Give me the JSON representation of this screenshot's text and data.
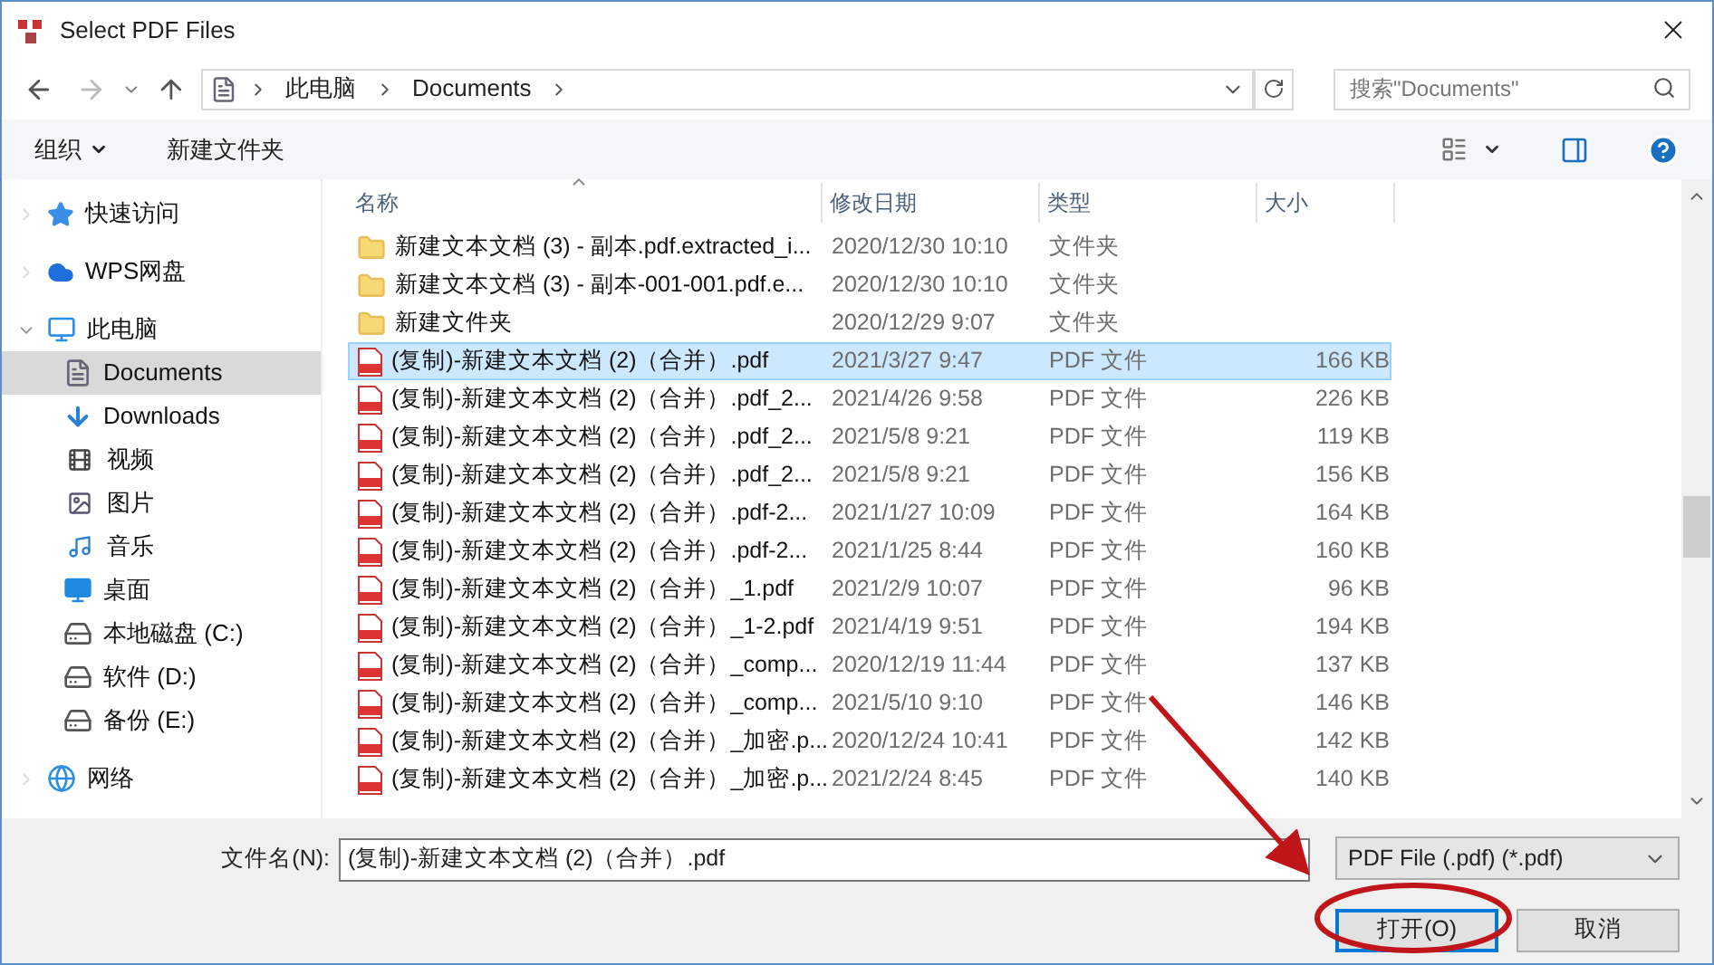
{
  "window": {
    "title": "Select PDF Files"
  },
  "address_bar": {
    "path": [
      "此电脑",
      "Documents"
    ]
  },
  "search": {
    "placeholder": "搜索\"Documents\""
  },
  "toolbar": {
    "organize": "组织",
    "new_folder": "新建文件夹"
  },
  "sidebar": {
    "items": [
      {
        "label": "快速访问",
        "kind": "star",
        "expanded": false,
        "selected": false
      },
      {
        "label": "WPS网盘",
        "kind": "cloud",
        "expanded": false,
        "selected": false
      },
      {
        "label": "此电脑",
        "kind": "pc",
        "expanded": true,
        "selected": false,
        "children": [
          {
            "label": "Documents",
            "kind": "doc",
            "selected": true
          },
          {
            "label": "Downloads",
            "kind": "download",
            "selected": false
          },
          {
            "label": "视频",
            "kind": "video",
            "selected": false
          },
          {
            "label": "图片",
            "kind": "picture",
            "selected": false
          },
          {
            "label": "音乐",
            "kind": "music",
            "selected": false
          },
          {
            "label": "桌面",
            "kind": "desktop",
            "selected": false
          },
          {
            "label": "本地磁盘 (C:)",
            "kind": "drive",
            "selected": false
          },
          {
            "label": "软件 (D:)",
            "kind": "drive",
            "selected": false
          },
          {
            "label": "备份 (E:)",
            "kind": "drive",
            "selected": false
          }
        ]
      },
      {
        "label": "网络",
        "kind": "network",
        "expanded": false,
        "selected": false
      }
    ]
  },
  "table": {
    "columns": [
      "名称",
      "修改日期",
      "类型",
      "大小"
    ],
    "rows": [
      {
        "kind": "folder",
        "name": "新建文本文档 (3) - 副本.pdf.extracted_i...",
        "date": "2020/12/30 10:10",
        "type": "文件夹",
        "selected": false
      },
      {
        "kind": "folder",
        "name": "新建文本文档 (3) - 副本-001-001.pdf.e...",
        "date": "2020/12/30 10:10",
        "type": "文件夹",
        "selected": false
      },
      {
        "kind": "folder",
        "name": "新建文件夹",
        "date": "2020/12/29 9:07",
        "type": "文件夹",
        "selected": false
      },
      {
        "kind": "pdf",
        "name": "(复制)-新建文本文档 (2)（合并）.pdf",
        "date": "2021/3/27 9:47",
        "type": "PDF 文件",
        "size": "166 KB",
        "selected": true
      },
      {
        "kind": "pdf",
        "name": "(复制)-新建文本文档 (2)（合并）.pdf_2...",
        "date": "2021/4/26 9:58",
        "type": "PDF 文件",
        "size": "226 KB",
        "selected": false
      },
      {
        "kind": "pdf",
        "name": "(复制)-新建文本文档 (2)（合并）.pdf_2...",
        "date": "2021/5/8 9:21",
        "type": "PDF 文件",
        "size": "119 KB",
        "selected": false
      },
      {
        "kind": "pdf",
        "name": "(复制)-新建文本文档 (2)（合并）.pdf_2...",
        "date": "2021/5/8 9:21",
        "type": "PDF 文件",
        "size": "156 KB",
        "selected": false
      },
      {
        "kind": "pdf",
        "name": "(复制)-新建文本文档 (2)（合并）.pdf-2...",
        "date": "2021/1/27 10:09",
        "type": "PDF 文件",
        "size": "164 KB",
        "selected": false
      },
      {
        "kind": "pdf",
        "name": "(复制)-新建文本文档 (2)（合并）.pdf-2...",
        "date": "2021/1/25 8:44",
        "type": "PDF 文件",
        "size": "160 KB",
        "selected": false
      },
      {
        "kind": "pdf",
        "name": "(复制)-新建文本文档 (2)（合并）_1.pdf",
        "date": "2021/2/9 10:07",
        "type": "PDF 文件",
        "size": "96 KB",
        "selected": false
      },
      {
        "kind": "pdf",
        "name": "(复制)-新建文本文档 (2)（合并）_1-2.pdf",
        "date": "2021/4/19 9:51",
        "type": "PDF 文件",
        "size": "194 KB",
        "selected": false
      },
      {
        "kind": "pdf",
        "name": "(复制)-新建文本文档 (2)（合并）_comp...",
        "date": "2020/12/19 11:44",
        "type": "PDF 文件",
        "size": "137 KB",
        "selected": false
      },
      {
        "kind": "pdf",
        "name": "(复制)-新建文本文档 (2)（合并）_comp...",
        "date": "2021/5/10 9:10",
        "type": "PDF 文件",
        "size": "146 KB",
        "selected": false
      },
      {
        "kind": "pdf",
        "name": "(复制)-新建文本文档 (2)（合并）_加密.p...",
        "date": "2020/12/24 10:41",
        "type": "PDF 文件",
        "size": "142 KB",
        "selected": false
      },
      {
        "kind": "pdf",
        "name": "(复制)-新建文本文档 (2)（合并）_加密.p...",
        "date": "2021/2/24 8:45",
        "type": "PDF 文件",
        "size": "140 KB",
        "selected": false
      }
    ]
  },
  "footer": {
    "filename_label": "文件名(N):",
    "filename_value": "(复制)-新建文本文档 (2)（合并）.pdf",
    "filter": "PDF File (.pdf) (*.pdf)",
    "open_button": "打开(O)",
    "cancel_button": "取消"
  }
}
